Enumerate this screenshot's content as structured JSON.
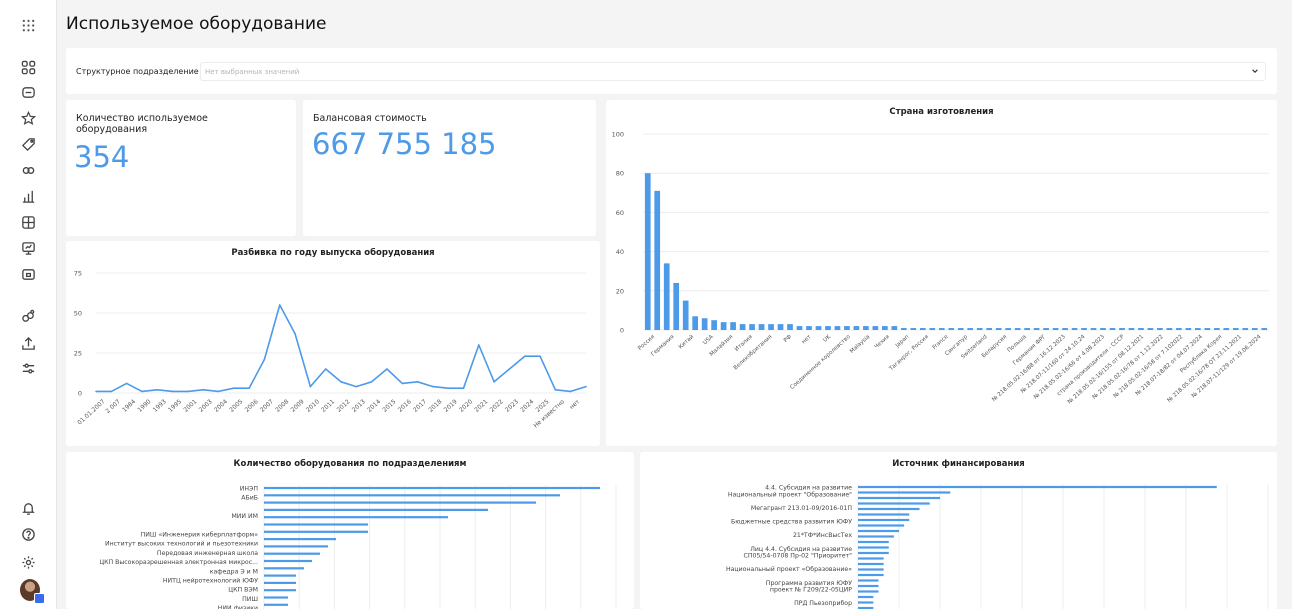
{
  "page": {
    "title": "Используемое оборудование"
  },
  "filter": {
    "label": "Структурное подразделение",
    "placeholder": "Нет выбранных значений"
  },
  "kpi": [
    {
      "label": "Количество используемое оборудования",
      "value": "354"
    },
    {
      "label": "Балансовая стоимость",
      "value": "667 755 185"
    }
  ],
  "sidebar": {
    "top_icons": [
      "grid-icon"
    ],
    "icons": [
      "apps-icon",
      "dashboard-icon",
      "star-icon",
      "tag-icon",
      "link-icon",
      "chart-icon",
      "table-icon",
      "presentation-icon",
      "folder-icon",
      "connection-icon",
      "upload-icon",
      "settings-sliders-icon"
    ],
    "bottom_icons": [
      "bell-icon",
      "help-icon",
      "gear-icon"
    ]
  },
  "charts": {
    "country": {
      "title": "Страна изготовления",
      "chart_data": {
        "type": "bar",
        "ylim": [
          0,
          100
        ],
        "yticks": [
          0,
          20,
          40,
          60,
          80,
          100
        ],
        "categories": [
          "Россия",
          "Германия",
          "Китай",
          "USA",
          "Малайзия",
          "Италия",
          "Великобритания",
          "РФ",
          "нет",
          "UK",
          "Соединенное королевство",
          "Malaysia",
          "Чехия",
          "Japan",
          "Таганрог, Россия",
          "France",
          "Сингапур",
          "Switzerland",
          "Беларусия",
          "Польша",
          "Германия ФРГ",
          "№ 218.05.02-16/88 от 16.12.2023",
          "№ 218.07-11/160 от 24.10.24",
          "№ 218.05.02-16/66 от 4.08.2023",
          "страна производителя - СССР",
          "№ 218.05.02-16/155 от 08.12.2021",
          "№ 218.05.02-16/78 от 1.12.2022",
          "№ 218.05.02-16/58 от 7.102022",
          "№ 218.07-18/82 от 04.07.2024",
          "Республика Корея",
          "№ 218.05.02-16/78 ОТ 23.11.2021",
          "№ 218.07-11/129 от 19.06.2024"
        ],
        "labeled_categories": [
          "Россия",
          "Германия",
          "Китай",
          "USA",
          "Малайзия",
          "Италия",
          "Великобритания",
          "РФ",
          "нет",
          "UK",
          "Соединенное королевство",
          "Malaysia",
          "Чехия",
          "Japan",
          "Таганрог, Россия",
          "France",
          "Сингапур",
          "Switzerland",
          "Беларусия",
          "Польша",
          "Германия ФРГ",
          "№ 218.05.02-16/88 от 16.12.2023",
          "№ 218.07-11/160 от 24.10.24",
          "№ 218.05.02-16/66 от 4.08.2023",
          "страна производителя - СССР",
          "№ 218.05.02-16/155 от 08.12.2021",
          "№ 218.05.02-16/78 от 1.12.2022",
          "№ 218.05.02-16/58 от 7.102022",
          "№ 218.07-18/82 от 04.07.2024",
          "Республика Корея",
          "№ 218.05.02-16/78 ОТ 23.11.2021",
          "№ 218.07-11/129 от 19.06.2024"
        ],
        "values": [
          80,
          71,
          34,
          24,
          15,
          7,
          6,
          5,
          4,
          4,
          3,
          3,
          3,
          3,
          3,
          3,
          2,
          2,
          2,
          2,
          2,
          2,
          2,
          2,
          2,
          2,
          2,
          1,
          1,
          1,
          1,
          1,
          1,
          1,
          1,
          1,
          1,
          1,
          1,
          1,
          1,
          1,
          1,
          1,
          1,
          1,
          1,
          1,
          1,
          1,
          1,
          1,
          1,
          1,
          1,
          1,
          1,
          1,
          1,
          1,
          1,
          1,
          1,
          1,
          1,
          1
        ]
      }
    },
    "year": {
      "title": "Разбивка по году выпуска оборудования",
      "chart_data": {
        "type": "line",
        "ylim": [
          0,
          75
        ],
        "yticks": [
          0,
          25,
          50,
          75
        ],
        "categories": [
          "01.01.2007",
          "2 007",
          "1984",
          "1990",
          "1993",
          "1995",
          "2001",
          "2003",
          "2004",
          "2005",
          "2006",
          "2007",
          "2008",
          "2009",
          "2010",
          "2011",
          "2012",
          "2013",
          "2014",
          "2015",
          "2016",
          "2017",
          "2018",
          "2019",
          "2020",
          "2021",
          "2022",
          "2023",
          "2024",
          "2025",
          "Не известно",
          "нет"
        ],
        "values": [
          1,
          1,
          6,
          1,
          2,
          1,
          1,
          2,
          1,
          3,
          3,
          21,
          55,
          37,
          4,
          15,
          7,
          4,
          7,
          15,
          6,
          7,
          4,
          3,
          3,
          30,
          7,
          15,
          23,
          23,
          2,
          1,
          4
        ]
      }
    },
    "departments": {
      "title": "Количество оборудования по подразделениям",
      "chart_data": {
        "type": "bar",
        "orientation": "horizontal",
        "categories": [
          "ИНЭП",
          "АБиБ",
          "",
          "МИИ ИМ",
          "",
          "ПИШ «Инженерия киберплатформ»",
          "Институт высоких технологий и пьезотехники",
          "Передовая инженерная школа",
          "ЦКП Высокоразрешенная электронная микрос...",
          "кафедра Э и М",
          "НИТЦ нейротехнологий ЮФУ",
          "ЦКП ВЭМ",
          "ПИШ",
          "НИИ физики"
        ],
        "values": [
          42,
          37,
          34,
          28,
          23,
          13,
          13,
          9,
          8,
          7,
          6,
          5,
          4,
          4,
          4,
          3,
          3,
          3
        ]
      }
    },
    "funding": {
      "title": "Источник финансирования",
      "chart_data": {
        "type": "bar",
        "orientation": "horizontal",
        "categories": [
          "4.4. Субсидия на развитие",
          "Национальный проект \"Образование\"",
          "",
          "Мегагрант 213.01-09/2016-01П",
          "",
          "Бюджетные средства развития ЮФУ",
          "",
          "21*ТФ*ИнсВысТех",
          "",
          "Лиц 4.4. Субсидия на развитие",
          "СП05/54-0708 Пр-02 \"Приоритет\"",
          "",
          "Национальный проект «Образование»",
          "",
          "Программа развития ЮФУ",
          "проект № Г209/22-05ЦИР",
          "",
          "ПРД Пьезоприбор",
          ""
        ],
        "values": [
          70,
          18,
          16,
          14,
          12,
          10,
          10,
          9,
          8,
          7,
          6,
          6,
          6,
          5,
          5,
          5,
          5,
          4,
          4,
          4,
          3,
          3,
          3,
          3
        ]
      }
    }
  }
}
